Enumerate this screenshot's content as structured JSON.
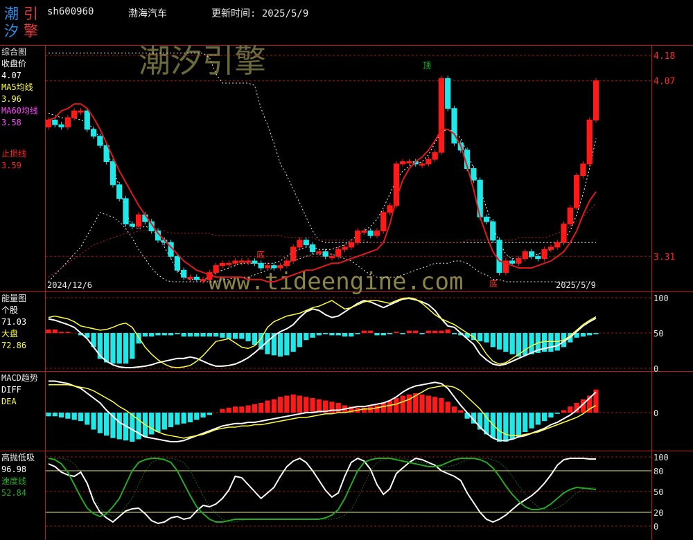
{
  "header": {
    "logo_chars": [
      "潮",
      "引",
      "汐",
      "擎"
    ],
    "code": "sh600960",
    "name": "渤海汽车",
    "update": "更新时间: 2025/5/9"
  },
  "watermarks": {
    "brand": "潮汐引擎",
    "url": "www.tideengine.com"
  },
  "colors": {
    "up": "#ff1a1a",
    "down": "#1ee8e8",
    "ma5": "#ffff33",
    "ma60": "#ff44ff",
    "stop": "#ff2020",
    "ma_line": "#dd1111",
    "energy_personal": "#ffffff",
    "energy_market": "#ffff33",
    "speed": "#22aa22"
  },
  "panels": {
    "main": {
      "title": "综合图",
      "labels": [
        {
          "text": "收盘价",
          "color": "#ffffff"
        },
        {
          "text": "4.07",
          "color": "#ffffff"
        },
        {
          "text": "MA5均线",
          "color": "#ffff33"
        },
        {
          "text": "3.96",
          "color": "#ffff33"
        },
        {
          "text": "MA60均线",
          "color": "#ff44ff"
        },
        {
          "text": "3.58",
          "color": "#ff44ff"
        },
        {
          "text": "止损线",
          "color": "#ff2020"
        },
        {
          "text": "3.59",
          "color": "#ff2020"
        }
      ]
    },
    "energy": {
      "title": "能量图",
      "labels": [
        {
          "text": "个股",
          "color": "#ffffff"
        },
        {
          "text": "71.03",
          "color": "#ffffff"
        },
        {
          "text": "大盘",
          "color": "#ffff33"
        },
        {
          "text": "72.86",
          "color": "#ffff33"
        }
      ]
    },
    "macd": {
      "title": "MACD趋势",
      "labels": [
        {
          "text": "DIFF",
          "color": "#ffffff"
        },
        {
          "text": "DEA",
          "color": "#ffff33"
        }
      ]
    },
    "gpdx": {
      "title": "高抛低吸",
      "labels": [
        {
          "text": "96.98",
          "color": "#ffffff"
        },
        {
          "text": "速度线",
          "color": "#22aa22"
        },
        {
          "text": "52.84",
          "color": "#22aa22"
        }
      ]
    }
  },
  "chart_data": [
    {
      "type": "candlestick",
      "name": "综合图",
      "x_start": "2024/12/6",
      "x_end": "2025/5/9",
      "right_axis": [
        "4.18",
        "4.07",
        "3.31"
      ],
      "annotations": [
        "顶",
        "底",
        "底"
      ],
      "close": [
        3.9,
        3.88,
        3.87,
        3.91,
        3.94,
        3.94,
        3.86,
        3.83,
        3.79,
        3.72,
        3.62,
        3.56,
        3.45,
        3.44,
        3.49,
        3.46,
        3.42,
        3.38,
        3.37,
        3.31,
        3.25,
        3.22,
        3.22,
        3.21,
        3.21,
        3.24,
        3.27,
        3.28,
        3.28,
        3.29,
        3.29,
        3.29,
        3.28,
        3.26,
        3.27,
        3.26,
        3.27,
        3.29,
        3.35,
        3.38,
        3.36,
        3.33,
        3.33,
        3.31,
        3.31,
        3.34,
        3.35,
        3.37,
        3.42,
        3.42,
        3.4,
        3.42,
        3.5,
        3.53,
        3.71,
        3.72,
        3.72,
        3.71,
        3.71,
        3.73,
        3.76,
        4.08,
        3.95,
        3.8,
        3.77,
        3.69,
        3.64,
        3.48,
        3.46,
        3.38,
        3.24,
        3.29,
        3.28,
        3.3,
        3.33,
        3.31,
        3.3,
        3.34,
        3.35,
        3.37,
        3.45,
        3.52,
        3.66,
        3.71,
        3.9,
        4.07
      ],
      "ma5": [
        3.93,
        3.92,
        3.91,
        3.91,
        3.91,
        3.9,
        3.89,
        3.86,
        3.82,
        3.77,
        3.7,
        3.61,
        3.5,
        3.44,
        3.43,
        3.44,
        3.43,
        3.4,
        3.35,
        3.3,
        3.25,
        3.22,
        3.21,
        3.21,
        3.21,
        3.22,
        3.24,
        3.25,
        3.26,
        3.27,
        3.28,
        3.28,
        3.28,
        3.28,
        3.28,
        3.28,
        3.29,
        3.31,
        3.33,
        3.34,
        3.35,
        3.35,
        3.34,
        3.34,
        3.34,
        3.35,
        3.36,
        3.38,
        3.4,
        3.42,
        3.44,
        3.47,
        3.52,
        3.58,
        3.64,
        3.68,
        3.7,
        3.71,
        3.72,
        3.75,
        3.8,
        3.85,
        3.86,
        3.85,
        3.82,
        3.76,
        3.69,
        3.6,
        3.52,
        3.44,
        3.37,
        3.32,
        3.3,
        3.3,
        3.3,
        3.31,
        3.32,
        3.33,
        3.34,
        3.36,
        3.38,
        3.42,
        3.49,
        3.58,
        3.69,
        3.82
      ],
      "ma60": [
        3.22,
        3.24,
        3.26,
        3.28,
        3.3,
        3.32,
        3.34,
        3.36,
        3.37,
        3.38,
        3.39,
        3.4,
        3.41,
        3.41,
        3.42,
        3.42,
        3.42,
        3.42,
        3.42,
        3.41,
        3.41,
        3.41,
        3.41,
        3.41,
        3.41,
        3.41,
        3.4,
        3.4,
        3.4,
        3.4,
        3.4,
        3.4,
        3.4,
        3.4,
        3.4,
        3.4,
        3.4,
        3.39,
        3.39,
        3.39,
        3.39,
        3.39,
        3.38,
        3.38,
        3.38,
        3.38,
        3.38,
        3.38,
        3.38,
        3.38,
        3.37,
        3.37,
        3.37,
        3.37,
        3.37,
        3.37,
        3.37,
        3.37,
        3.37,
        3.37,
        3.37,
        3.37,
        3.37,
        3.37,
        3.37,
        3.38,
        3.38,
        3.38,
        3.38,
        3.38,
        3.38,
        3.38,
        3.38,
        3.39,
        3.39,
        3.39,
        3.39,
        3.39,
        3.4,
        3.41,
        3.42,
        3.44,
        3.46,
        3.48,
        3.51,
        3.54
      ],
      "stop": [
        3.9,
        3.91,
        3.94,
        3.95,
        3.97,
        3.97,
        3.95,
        3.91,
        3.86,
        3.8,
        3.74,
        3.68,
        3.63,
        3.58,
        3.53,
        3.49,
        3.45,
        3.41,
        3.38,
        3.35,
        3.32,
        3.29,
        3.27,
        3.25,
        3.24,
        3.23,
        3.22,
        3.22,
        3.22,
        3.22,
        3.22,
        3.21,
        3.21,
        3.21,
        3.2,
        3.2,
        3.21,
        3.22,
        3.23,
        3.24,
        3.25,
        3.25,
        3.26,
        3.27,
        3.28,
        3.28,
        3.29,
        3.3,
        3.31,
        3.32,
        3.33,
        3.34,
        3.37,
        3.45,
        3.56,
        3.64,
        3.69,
        3.72,
        3.74,
        3.77,
        3.81,
        3.86,
        3.86,
        3.84,
        3.79,
        3.7,
        3.6,
        3.48,
        3.4,
        3.33,
        3.29,
        3.28,
        3.27,
        3.26,
        3.26,
        3.26,
        3.27,
        3.28,
        3.29,
        3.31,
        3.33,
        3.37,
        3.42,
        3.49,
        3.55,
        3.59
      ],
      "band_upper": [
        4.19,
        4.19,
        4.19,
        4.19,
        4.19,
        4.19,
        4.19,
        4.19,
        4.19,
        4.19,
        4.19,
        4.19,
        4.19,
        4.19,
        4.19,
        4.19,
        4.19,
        4.19,
        4.19,
        4.19,
        4.19,
        4.19,
        4.19,
        4.19,
        4.19,
        4.17,
        4.1,
        4.06,
        4.06,
        4.06,
        4.06,
        4.06,
        4.05,
        3.95,
        3.88,
        3.8,
        3.71,
        3.66,
        3.6,
        3.54,
        3.48,
        3.42,
        3.38,
        3.37,
        3.37,
        3.37,
        3.37,
        3.37,
        3.37,
        3.37,
        3.37,
        3.37,
        3.37,
        3.37,
        3.37,
        3.37,
        3.37,
        3.37,
        3.37,
        3.37,
        3.37,
        3.37,
        3.37,
        3.37,
        3.37,
        3.37,
        3.37,
        3.37,
        3.37,
        3.37,
        3.37,
        3.37,
        3.37,
        3.37,
        3.37,
        3.37,
        3.37,
        3.37,
        3.37,
        3.37,
        3.37,
        3.37,
        3.37,
        3.37,
        3.37,
        3.37
      ],
      "band_lower": [
        3.2,
        3.23,
        3.26,
        3.29,
        3.32,
        3.35,
        3.4,
        3.45,
        3.5,
        3.49,
        3.48,
        3.46,
        3.43,
        3.39,
        3.34,
        3.3,
        3.26,
        3.23,
        3.21,
        3.2,
        3.2,
        3.2,
        3.2,
        3.2,
        3.2,
        3.2,
        3.2,
        3.21,
        3.21,
        3.22,
        3.22,
        3.22,
        3.23,
        3.24,
        3.25,
        3.26,
        3.27,
        3.28,
        3.29,
        3.3,
        3.31,
        3.32,
        3.32,
        3.32,
        3.32,
        3.31,
        3.3,
        3.29,
        3.27,
        3.25,
        3.23,
        3.22,
        3.22,
        3.22,
        3.22,
        3.23,
        3.24,
        3.25,
        3.26,
        3.27,
        3.28,
        3.28,
        3.28,
        3.29,
        3.29,
        3.28,
        3.26,
        3.24,
        3.23,
        3.21,
        3.21,
        3.2,
        3.2,
        3.2,
        3.2,
        3.2,
        3.2,
        3.2,
        3.2,
        3.2,
        3.2,
        3.2,
        3.2,
        3.2,
        3.2,
        3.2
      ],
      "y_range": [
        3.17,
        4.21
      ]
    },
    {
      "type": "line+bar",
      "name": "能量图",
      "right_axis": [
        100,
        50,
        0
      ],
      "y_range": [
        0,
        100
      ],
      "personal": [
        70,
        68,
        65,
        62,
        58,
        50,
        42,
        30,
        18,
        10,
        5,
        2,
        1,
        1,
        2,
        3,
        5,
        8,
        10,
        12,
        14,
        14,
        16,
        14,
        10,
        6,
        3,
        3,
        4,
        6,
        10,
        15,
        22,
        30,
        38,
        46,
        52,
        56,
        62,
        72,
        80,
        84,
        82,
        76,
        72,
        74,
        80,
        86,
        92,
        96,
        94,
        90,
        86,
        90,
        94,
        98,
        99,
        97,
        94,
        90,
        82,
        70,
        60,
        58,
        50,
        42,
        34,
        20,
        12,
        6,
        4,
        6,
        10,
        14,
        18,
        22,
        26,
        28,
        30,
        32,
        38,
        44,
        52,
        60,
        66,
        71
      ],
      "market": [
        72,
        74,
        72,
        70,
        66,
        60,
        58,
        56,
        54,
        55,
        58,
        62,
        64,
        58,
        44,
        30,
        20,
        12,
        6,
        2,
        1,
        2,
        4,
        10,
        18,
        28,
        38,
        40,
        42,
        36,
        30,
        28,
        32,
        42,
        58,
        66,
        70,
        74,
        76,
        78,
        82,
        86,
        88,
        92,
        96,
        90,
        84,
        86,
        90,
        94,
        96,
        96,
        94,
        92,
        96,
        99,
        100,
        98,
        92,
        84,
        76,
        70,
        66,
        62,
        56,
        50,
        44,
        34,
        20,
        10,
        6,
        8,
        14,
        20,
        26,
        32,
        36,
        38,
        38,
        38,
        40,
        46,
        54,
        62,
        68,
        73
      ],
      "bars": [
        3,
        3,
        1,
        1,
        0,
        -2,
        -4,
        -12,
        -22,
        -25,
        -26,
        -26,
        -26,
        -22,
        -9,
        -3,
        -3,
        -2,
        -2,
        -2,
        -1,
        -3,
        -3,
        -3,
        -3,
        -3,
        -3,
        -4,
        -5,
        -5,
        -5,
        -7,
        -10,
        -14,
        -18,
        -19,
        -20,
        -19,
        -16,
        -12,
        -6,
        -4,
        -2,
        -1,
        -2,
        -2,
        -3,
        -3,
        -1,
        2,
        2,
        -2,
        -2,
        -1,
        1,
        -1,
        2,
        2,
        -1,
        2,
        2,
        2,
        3,
        -1,
        -2,
        -4,
        -6,
        -7,
        -8,
        -12,
        -14,
        -16,
        -18,
        -20,
        -19,
        -18,
        -17,
        -16,
        -16,
        -15,
        -12,
        -8,
        -4,
        -3,
        -2,
        -1
      ],
      "bars_range": [
        -30,
        30
      ]
    },
    {
      "type": "line+bar",
      "name": "MACD趋势",
      "right_axis": [
        0
      ],
      "y_range": [
        -0.28,
        0.28
      ],
      "diff": [
        0.26,
        0.26,
        0.25,
        0.24,
        0.22,
        0.2,
        0.16,
        0.12,
        0.08,
        0.02,
        -0.03,
        -0.08,
        -0.11,
        -0.14,
        -0.17,
        -0.2,
        -0.21,
        -0.22,
        -0.23,
        -0.24,
        -0.24,
        -0.23,
        -0.21,
        -0.19,
        -0.17,
        -0.15,
        -0.13,
        -0.11,
        -0.1,
        -0.09,
        -0.09,
        -0.08,
        -0.08,
        -0.07,
        -0.06,
        -0.05,
        -0.04,
        -0.03,
        -0.02,
        -0.01,
        0.0,
        0.0,
        0.01,
        0.01,
        0.02,
        0.02,
        0.03,
        0.04,
        0.05,
        0.05,
        0.06,
        0.07,
        0.08,
        0.1,
        0.13,
        0.17,
        0.2,
        0.22,
        0.23,
        0.24,
        0.25,
        0.24,
        0.2,
        0.13,
        0.06,
        0.0,
        -0.06,
        -0.12,
        -0.17,
        -0.21,
        -0.23,
        -0.23,
        -0.22,
        -0.2,
        -0.19,
        -0.17,
        -0.15,
        -0.13,
        -0.1,
        -0.08,
        -0.05,
        -0.02,
        0.02,
        0.07,
        0.12,
        0.17
      ],
      "dea": [
        0.23,
        0.23,
        0.23,
        0.23,
        0.22,
        0.21,
        0.2,
        0.18,
        0.15,
        0.12,
        0.09,
        0.05,
        0.02,
        -0.02,
        -0.06,
        -0.1,
        -0.13,
        -0.16,
        -0.18,
        -0.19,
        -0.2,
        -0.21,
        -0.2,
        -0.19,
        -0.18,
        -0.16,
        -0.14,
        -0.13,
        -0.12,
        -0.12,
        -0.11,
        -0.11,
        -0.1,
        -0.1,
        -0.09,
        -0.08,
        -0.07,
        -0.06,
        -0.05,
        -0.04,
        -0.04,
        -0.03,
        -0.02,
        -0.01,
        -0.01,
        0.0,
        0.0,
        0.01,
        0.02,
        0.03,
        0.03,
        0.04,
        0.05,
        0.06,
        0.07,
        0.09,
        0.11,
        0.14,
        0.17,
        0.2,
        0.21,
        0.22,
        0.22,
        0.21,
        0.18,
        0.13,
        0.08,
        0.03,
        -0.04,
        -0.1,
        -0.15,
        -0.18,
        -0.19,
        -0.19,
        -0.18,
        -0.17,
        -0.16,
        -0.14,
        -0.12,
        -0.1,
        -0.08,
        -0.06,
        -0.04,
        -0.01,
        0.03,
        0.06
      ],
      "hist": [
        -0.03,
        -0.03,
        -0.04,
        -0.05,
        -0.06,
        -0.07,
        -0.1,
        -0.14,
        -0.17,
        -0.19,
        -0.21,
        -0.22,
        -0.23,
        -0.24,
        -0.22,
        -0.2,
        -0.18,
        -0.16,
        -0.14,
        -0.12,
        -0.1,
        -0.09,
        -0.08,
        -0.06,
        -0.04,
        -0.02,
        0.0,
        0.03,
        0.04,
        0.05,
        0.05,
        0.06,
        0.07,
        0.08,
        0.1,
        0.11,
        0.13,
        0.14,
        0.15,
        0.14,
        0.13,
        0.12,
        0.11,
        0.1,
        0.09,
        0.08,
        0.06,
        0.05,
        0.04,
        0.04,
        0.05,
        0.06,
        0.08,
        0.1,
        0.12,
        0.14,
        0.15,
        0.16,
        0.15,
        0.14,
        0.13,
        0.12,
        0.09,
        0.05,
        0.02,
        -0.05,
        -0.09,
        -0.14,
        -0.18,
        -0.21,
        -0.24,
        -0.24,
        -0.22,
        -0.2,
        -0.16,
        -0.13,
        -0.1,
        -0.07,
        -0.04,
        -0.01,
        0.02,
        0.05,
        0.08,
        0.11,
        0.14,
        0.19
      ],
      "hist_range": [
        -0.28,
        0.28
      ]
    },
    {
      "type": "line",
      "name": "高抛低吸",
      "right_axis": [
        100,
        80,
        50,
        20,
        0
      ],
      "y_range": [
        0,
        100
      ],
      "hline_values": [
        80,
        50,
        20
      ],
      "line": [
        90,
        86,
        78,
        74,
        72,
        78,
        62,
        36,
        20,
        12,
        6,
        14,
        22,
        25,
        26,
        18,
        8,
        4,
        6,
        12,
        14,
        10,
        12,
        22,
        30,
        28,
        32,
        40,
        52,
        72,
        70,
        60,
        50,
        40,
        48,
        56,
        72,
        86,
        94,
        98,
        92,
        80,
        66,
        52,
        42,
        48,
        72,
        92,
        98,
        94,
        82,
        60,
        46,
        54,
        76,
        84,
        92,
        98,
        96,
        92,
        88,
        80,
        76,
        72,
        66,
        48,
        34,
        20,
        10,
        6,
        10,
        16,
        24,
        32,
        38,
        44,
        52,
        62,
        74,
        88,
        96,
        98,
        98,
        98,
        97,
        97
      ],
      "speed_line": [
        98,
        96,
        90,
        78,
        60,
        42,
        26,
        18,
        14,
        18,
        28,
        40,
        60,
        80,
        92,
        96,
        98,
        98,
        96,
        92,
        80,
        62,
        44,
        28,
        18,
        10,
        6,
        6,
        8,
        10,
        10,
        10,
        10,
        10,
        10,
        10,
        10,
        10,
        10,
        10,
        10,
        10,
        10,
        12,
        16,
        24,
        40,
        60,
        80,
        92,
        96,
        98,
        98,
        98,
        96,
        94,
        92,
        90,
        88,
        86,
        86,
        88,
        92,
        96,
        98,
        98,
        98,
        96,
        92,
        84,
        72,
        58,
        46,
        36,
        28,
        24,
        24,
        26,
        32,
        40,
        48,
        53,
        56,
        55,
        54,
        53
      ]
    }
  ]
}
